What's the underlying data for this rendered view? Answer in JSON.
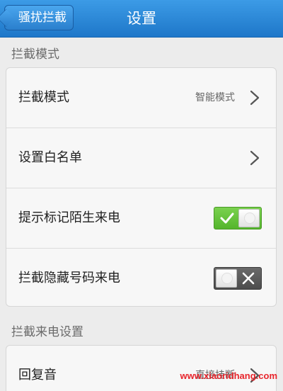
{
  "header": {
    "back_label": "骚扰拦截",
    "title": "设置"
  },
  "sections": [
    {
      "label": "拦截模式",
      "rows": [
        {
          "label": "拦截模式",
          "value": "智能模式",
          "control": "chevron"
        },
        {
          "label": "设置白名单",
          "control": "chevron"
        },
        {
          "label": "提示标记陌生来电",
          "control": "toggle",
          "state": "on"
        },
        {
          "label": "拦截隐藏号码来电",
          "control": "toggle",
          "state": "off"
        }
      ]
    },
    {
      "label": "拦截来电设置",
      "rows": [
        {
          "label": "回复音",
          "value": "直接挂断",
          "control": "chevron"
        }
      ]
    }
  ],
  "colors": {
    "header_blue": "#2a86d6",
    "toggle_on": "#5cbf33",
    "toggle_off": "#555555"
  },
  "icons": {
    "chevron": "chevron-right-icon",
    "check": "check-icon",
    "cross": "close-icon"
  },
  "watermark": "www.xiaoridhang.com"
}
